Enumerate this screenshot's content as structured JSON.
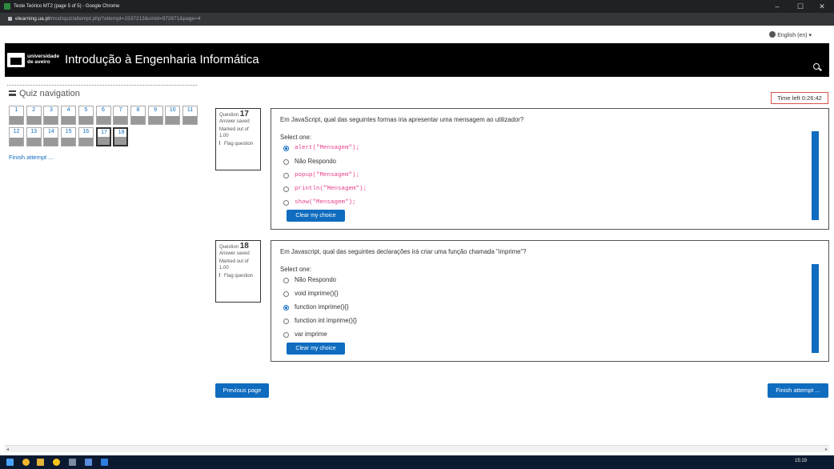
{
  "browser": {
    "title": "Teste Teórico MT2 (page 5 of 5) - Google Chrome",
    "url_domain": "elearning.ua.pt",
    "url_path": "/mod/quiz/attempt.php?attempt=1537213&cmid=972871&page=4",
    "minimize": "–",
    "maximize": "☐",
    "close": "✕"
  },
  "lang_menu": "English (en) ▾",
  "header": {
    "logo_line1": "universidade",
    "logo_line2": "de aveiro",
    "site_title": "Introdução à Engenharia Informática"
  },
  "quiz_nav": {
    "title": "Quiz navigation",
    "buttons": [
      "1",
      "2",
      "3",
      "4",
      "5",
      "6",
      "7",
      "8",
      "9",
      "10",
      "11",
      "12",
      "13",
      "14",
      "15",
      "16",
      "17",
      "18"
    ],
    "finish_link": "Finish attempt ..."
  },
  "timer": "Time left 0:26:42",
  "questions": [
    {
      "label": "Question",
      "number": "17",
      "state": "Answer saved",
      "marked": "Marked out of 1.00",
      "flag": "Flag question",
      "text": "Em JavaScript, qual das seguintes formas iria apresentar uma mensagem ao utilizador?",
      "select_one": "Select one:",
      "options": [
        {
          "text": "alert(\"Mensagem\");",
          "code": true,
          "selected": true
        },
        {
          "text": "Não Respondo",
          "code": false,
          "selected": false
        },
        {
          "text": "popup(\"Mensagem\");",
          "code": true,
          "selected": false
        },
        {
          "text": "println(\"Mensagem\");",
          "code": true,
          "selected": false
        },
        {
          "text": "show(\"Mensagem\");",
          "code": true,
          "selected": false
        }
      ],
      "clear": "Clear my choice"
    },
    {
      "label": "Question",
      "number": "18",
      "state": "Answer saved",
      "marked": "Marked out of 1.00",
      "flag": "Flag question",
      "text": "Em Javascript, qual das seguintes declarações irá criar uma função chamada \"imprime\"?",
      "select_one": "Select one:",
      "options": [
        {
          "text": "Não Respondo",
          "code": false,
          "selected": false
        },
        {
          "text": "void imprime(){}",
          "code": false,
          "selected": false
        },
        {
          "text": "function imprime(){}",
          "code": false,
          "selected": true
        },
        {
          "text": "function int imprime(){}",
          "code": false,
          "selected": false
        },
        {
          "text": "var imprime",
          "code": false,
          "selected": false
        }
      ],
      "clear": "Clear my choice"
    }
  ],
  "buttons": {
    "previous": "Previous page",
    "finish": "Finish attempt ..."
  },
  "taskbar": {
    "clock": "15:19"
  },
  "colors": {
    "primary": "#0f6cbf",
    "header_bg": "#000000",
    "code": "#e83e8c"
  }
}
